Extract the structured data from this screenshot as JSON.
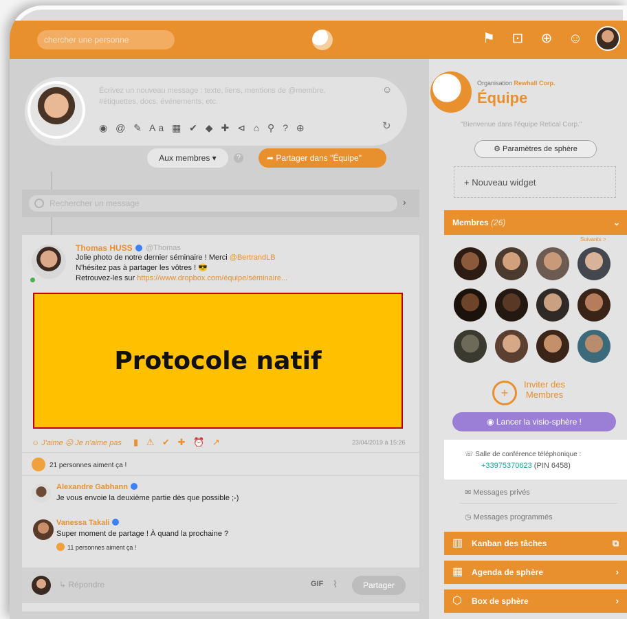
{
  "topbar": {
    "search_placeholder": "chercher une personne",
    "icons": [
      "flag-icon",
      "new-topic-icon",
      "new-sphere-icon",
      "new-contact-icon"
    ]
  },
  "composer": {
    "placeholder_line1": "Écrivez un nouveau message : texte, liens, mentions de @membre,",
    "placeholder_line2": "#étiquettes, docs, événements, etc.",
    "tools": "◉ @ ✎ Aa ▦ ✔ ◆ ✚ ⊲ ⌂ ⚲ ? ⊕",
    "audience_label": "Aux membres ▾",
    "help": "?",
    "share_label": "➦  Partager dans \"Équipe\""
  },
  "message_search": {
    "placeholder": "Rechercher un message"
  },
  "post": {
    "author": "Thomas HUSS",
    "handle": "@Thomas",
    "line1": "Jolie photo de notre dernier séminaire ! Merci ",
    "mention": "@BertrandLB",
    "line2": "N'hésitez pas à partager les vôtres ! 😎",
    "line3": "Retrouvez-les sur ",
    "link": "https://www.dropbox.com/équipe/séminaire...",
    "overlay_text": "Protocole natif",
    "like_label": "☺ J'aime   ☹ Je n'aime pas",
    "date": "23/04/2019 à 15:26",
    "likes_text": "21 personnes aiment ça !"
  },
  "comments": [
    {
      "author": "Alexandre Gabhann",
      "text": "Je vous envoie la deuxième partie dès que possible ;-)"
    },
    {
      "author": "Vanessa Takali",
      "text": "Super moment de partage ! À quand la prochaine ?",
      "likes": "11 personnes aiment ça !"
    }
  ],
  "reply": {
    "placeholder": "↳ Répondre",
    "gif": "GIF",
    "share": "Partager"
  },
  "sidebar": {
    "org_prefix": "Organisation",
    "org_name": "Rewhall Corp.",
    "title": "Équipe",
    "welcome": "\"Bienvenue dans l'équipe Retical Corp.\"",
    "params_button": "⚙ Paramètres de sphère",
    "new_widget": "+  Nouveau widget",
    "members_label": "Membres",
    "members_count": "(26)",
    "next_link": "Suivants >",
    "invite_line1": "Inviter des",
    "invite_line2": "Membres",
    "visio_button": "◉  Lancer la visio-sphère !",
    "conf_label": "☏ Salle de conférence téléphonique :",
    "conf_number": "+33975370623",
    "conf_pin": " (PIN 6458)",
    "private_messages": "✉  Messages privés",
    "scheduled_messages": "◷  Messages programmés",
    "kanban": "Kanban des tâches",
    "agenda": "Agenda de sphère",
    "box": "Box de sphère"
  },
  "colors": {
    "accent": "#e8902e",
    "visio": "#9b7fd6",
    "phone": "#14a89d",
    "overlay_fill": "#ffc000",
    "overlay_border": "#c00000"
  }
}
